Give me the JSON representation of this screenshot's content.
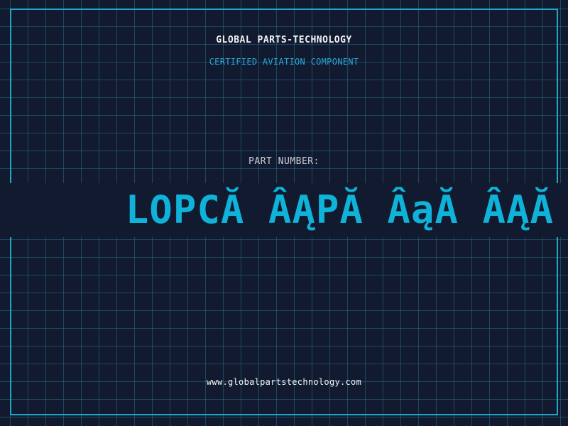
{
  "header": {
    "company": "GLOBAL PARTS-TECHNOLOGY",
    "tagline": "CERTIFIED AVIATION COMPONENT"
  },
  "part": {
    "label": "PART NUMBER:",
    "value": "LOPCĂ ÂĄPĂ ÂąĂ ÂĄĂ"
  },
  "footer": {
    "website": "www.globalpartstechnology.com"
  },
  "colors": {
    "background": "#121a2f",
    "grid": "#266e8c",
    "frame": "#1ea7c9",
    "accent": "#0fb2d8",
    "text": "#f2f4f7"
  }
}
